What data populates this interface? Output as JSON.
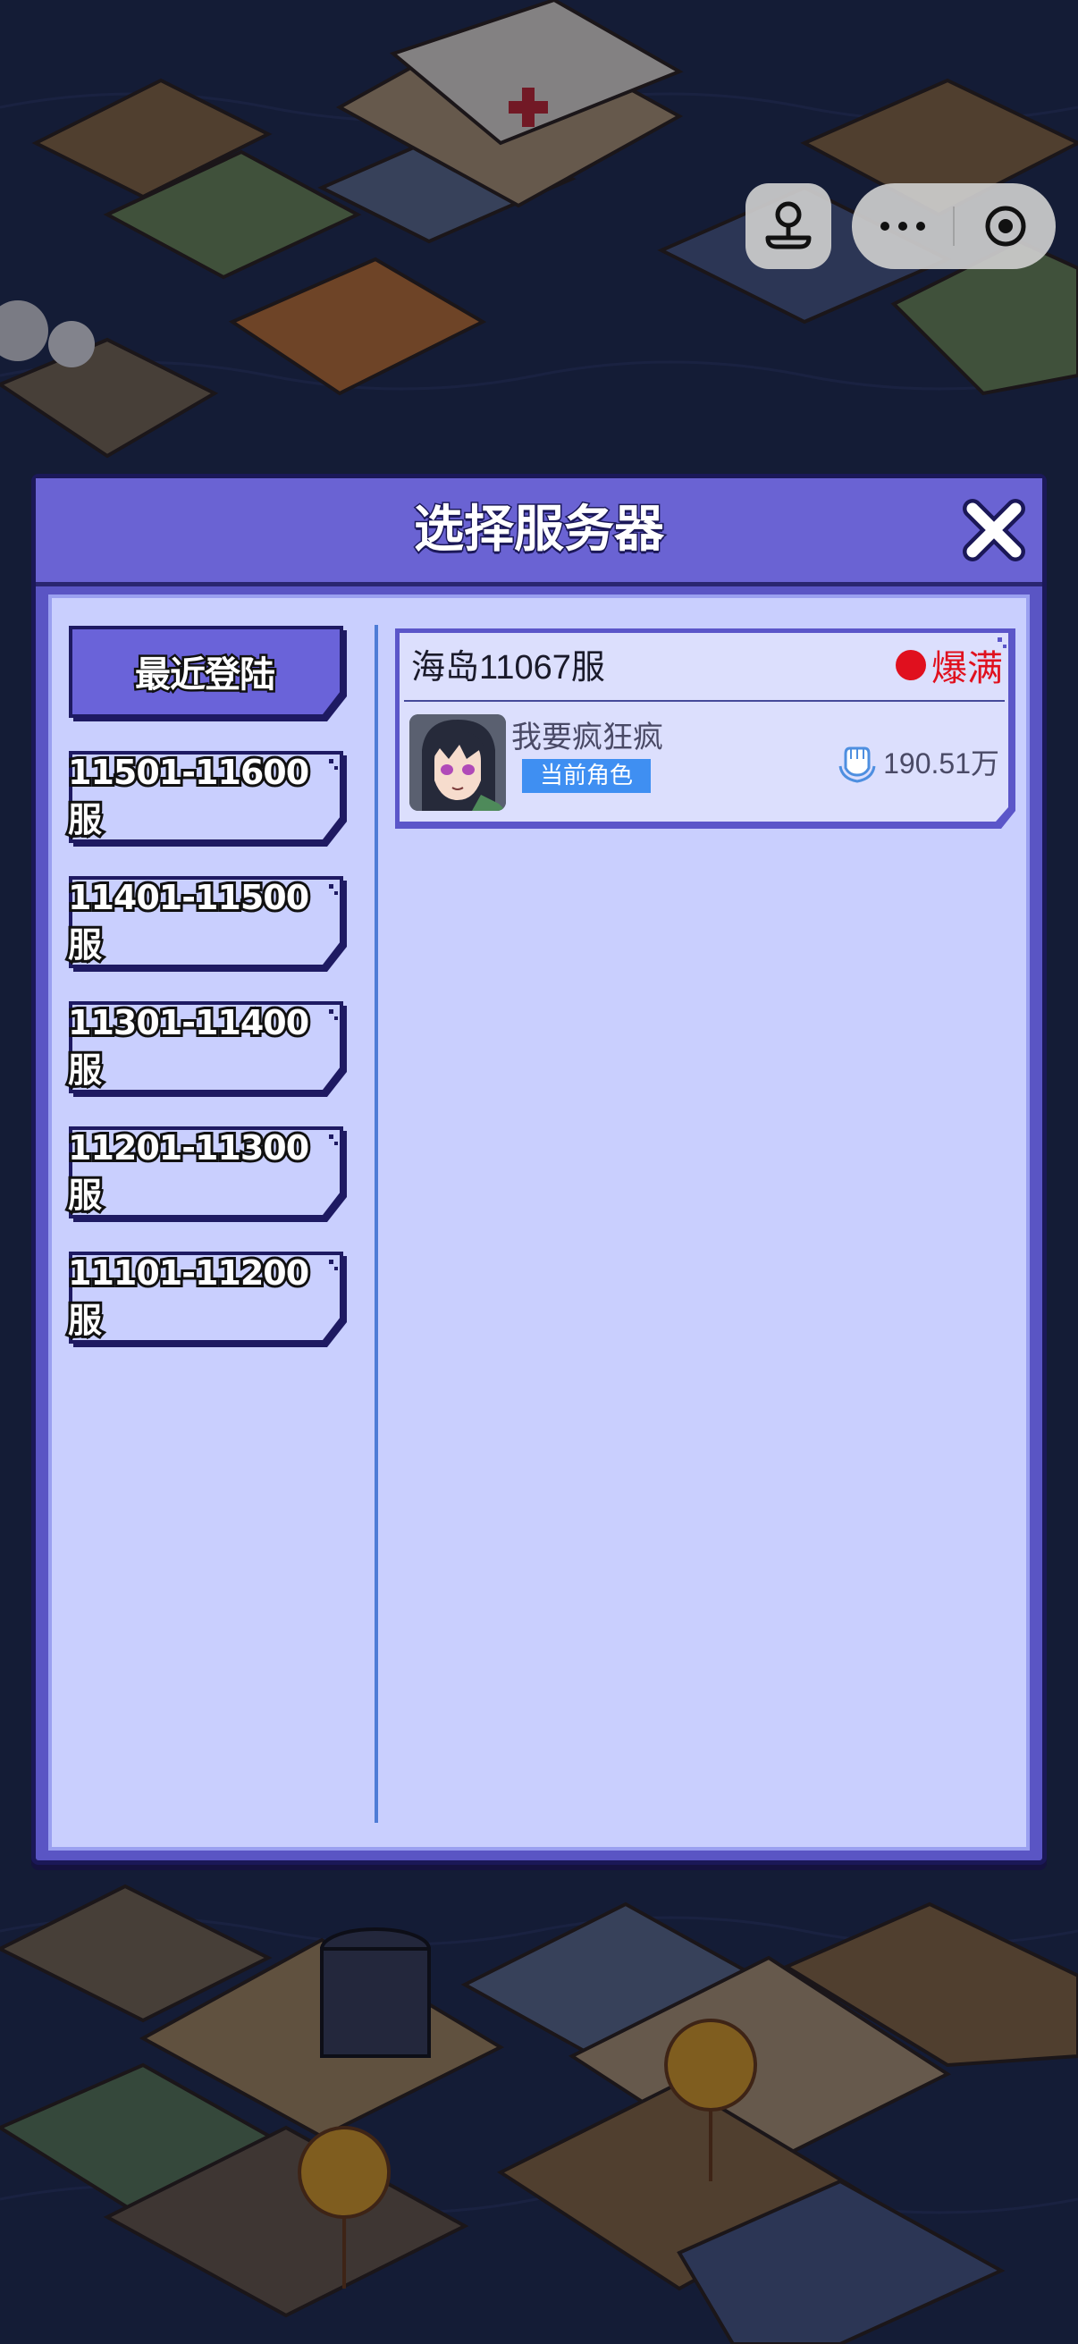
{
  "dialog": {
    "title": "选择服务器"
  },
  "server_ranges": [
    {
      "label": "最近登陆",
      "active": true
    },
    {
      "label": "11501-11600服",
      "active": false
    },
    {
      "label": "11401-11500服",
      "active": false
    },
    {
      "label": "11301-11400服",
      "active": false
    },
    {
      "label": "11201-11300服",
      "active": false
    },
    {
      "label": "11101-11200服",
      "active": false
    }
  ],
  "server_card": {
    "server_name": "海岛11067服",
    "status_label": "爆满",
    "role_name": "我要疯狂疯",
    "current_badge": "当前角色",
    "power_value": "190.51万"
  },
  "colors": {
    "dialog_frame": "#5a55c4",
    "panel_bg": "#c9cffe",
    "status_red": "#e0101e",
    "badge_blue": "#3f8ff2"
  },
  "icons": {
    "close": "close-icon",
    "power": "power-fist-icon",
    "capsule_game": "joystick-icon",
    "capsule_more": "more-icon",
    "capsule_exit": "target-icon"
  }
}
